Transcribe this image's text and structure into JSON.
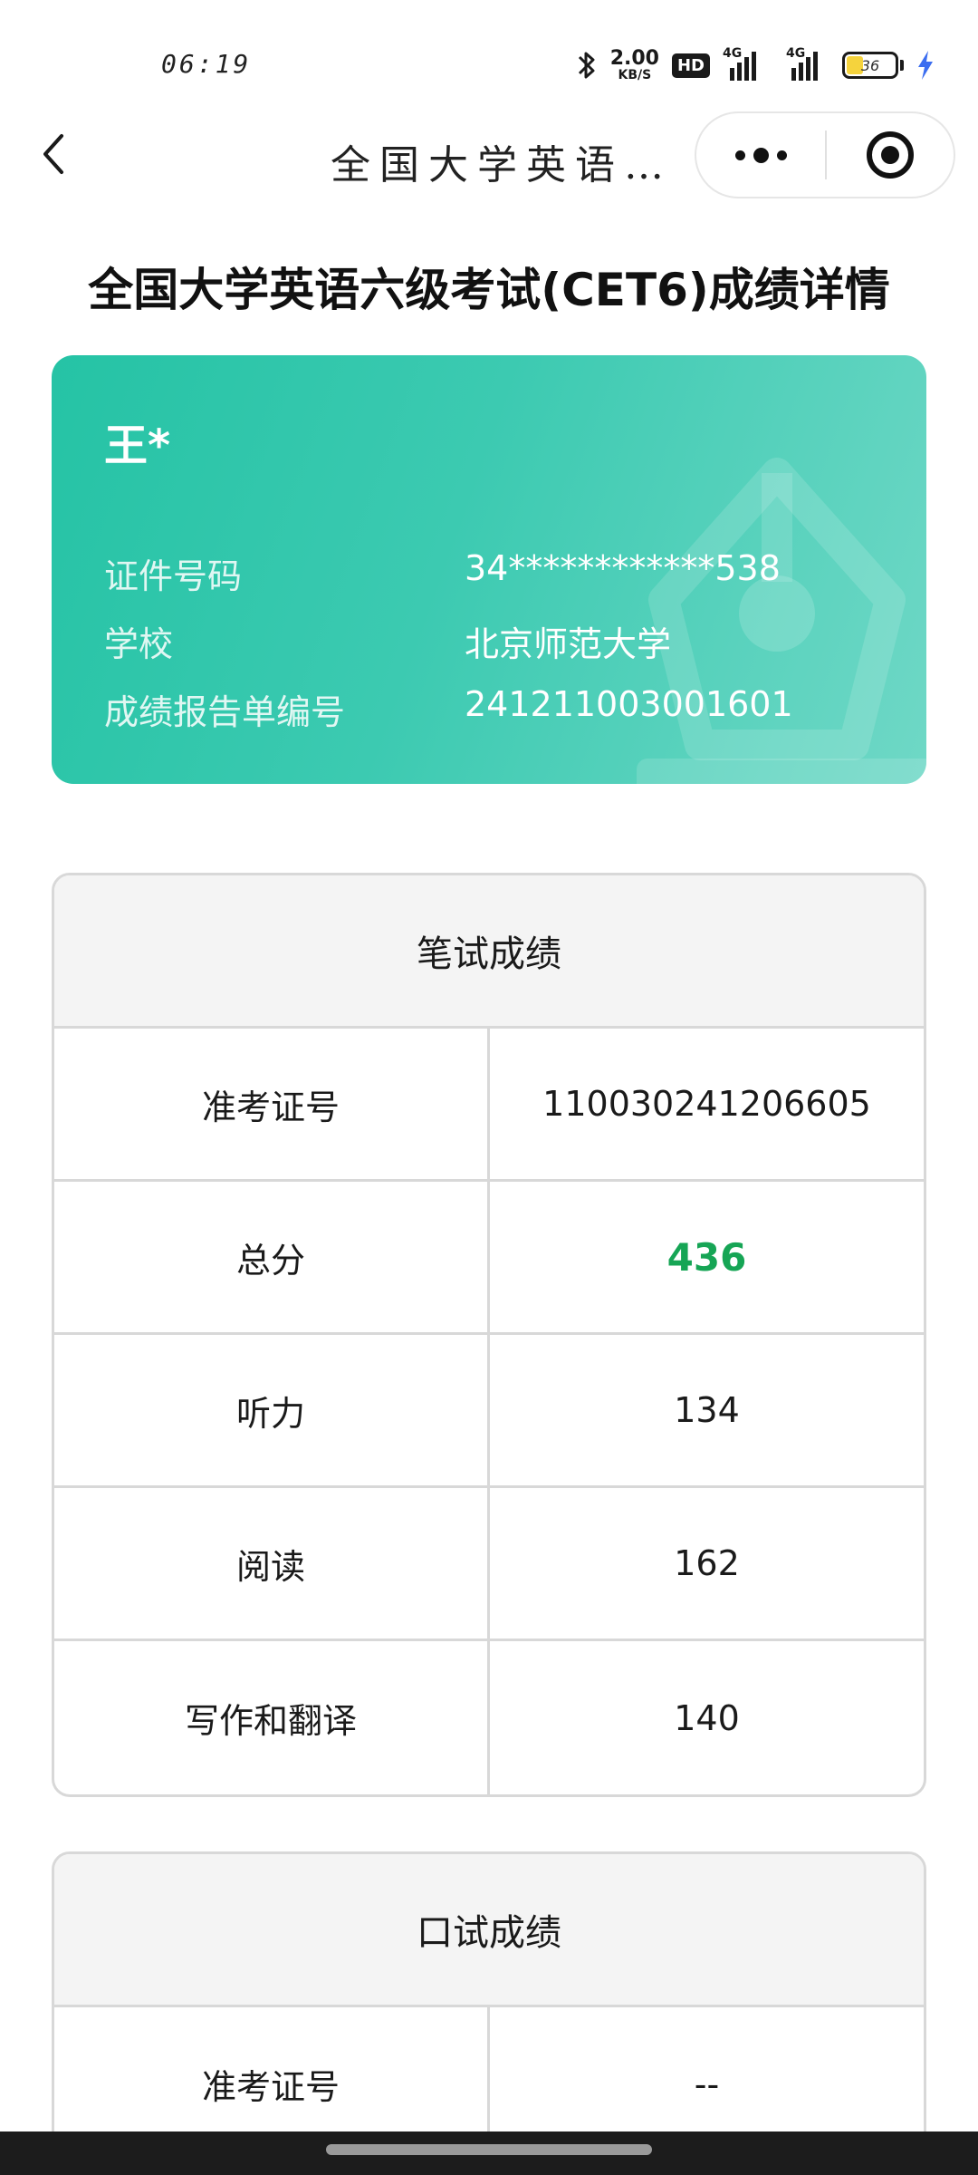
{
  "status_bar": {
    "time": "06:19",
    "net_speed_value": "2.00",
    "net_speed_unit": "KB/S",
    "hd_badge": "HD",
    "signal_1_tag": "4G",
    "signal_2_tag": "4G",
    "battery_level": "36"
  },
  "nav": {
    "title": "全国大学英语…"
  },
  "page": {
    "title": "全国大学英语六级考试(CET6)成绩详情"
  },
  "profile": {
    "name": "王*",
    "rows": [
      {
        "key": "证件号码",
        "value": "34************538"
      },
      {
        "key": "学校",
        "value": "北京师范大学"
      },
      {
        "key": "成绩报告单编号",
        "value": "241211003001601"
      }
    ]
  },
  "written": {
    "header": "笔试成绩",
    "rows": [
      {
        "key": "准考证号",
        "value": "110030241206605"
      },
      {
        "key": "总分",
        "value": "436"
      },
      {
        "key": "听力",
        "value": "134"
      },
      {
        "key": "阅读",
        "value": "162"
      },
      {
        "key": "写作和翻译",
        "value": "140"
      }
    ]
  },
  "oral": {
    "header": "口试成绩",
    "rows": [
      {
        "key": "准考证号",
        "value": "--"
      }
    ]
  },
  "colors": {
    "card_gradient_start": "#25c3a5",
    "card_gradient_end": "#6fd8c6",
    "total_score": "#16a555"
  }
}
